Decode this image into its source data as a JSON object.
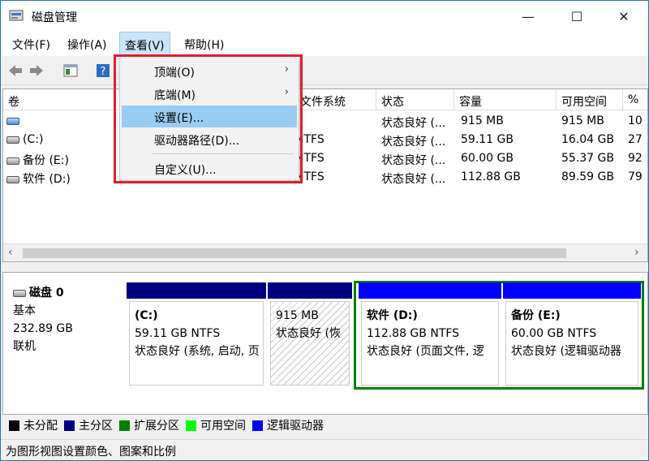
{
  "window": {
    "title": "磁盘管理",
    "minimize": "—",
    "maximize": "☐",
    "close": "✕"
  },
  "menubar": [
    {
      "label": "文件(F)"
    },
    {
      "label": "操作(A)"
    },
    {
      "label": "查看(V)"
    },
    {
      "label": "帮助(H)"
    }
  ],
  "view_menu": [
    {
      "label": "顶端(O)",
      "arrow": "›"
    },
    {
      "label": "底端(M)",
      "arrow": "›"
    },
    {
      "label": "设置(E)..."
    },
    {
      "label": "驱动器路径(D)..."
    },
    {
      "label": "自定义(U)..."
    }
  ],
  "volume_list": {
    "headers": [
      "卷",
      "文件系统",
      "状态",
      "容量",
      "可用空间",
      "%"
    ],
    "rows": [
      {
        "vol": "",
        "fs": "",
        "status": "状态良好 (...",
        "cap": "915 MB",
        "free": "915 MB",
        "pct": "10"
      },
      {
        "vol": "(C:)",
        "fs": "NTFS",
        "status": "状态良好 (...",
        "cap": "59.11 GB",
        "free": "16.04 GB",
        "pct": "27"
      },
      {
        "vol": "备份 (E:)",
        "fs": "NTFS",
        "status": "状态良好 (...",
        "cap": "60.00 GB",
        "free": "55.37 GB",
        "pct": "92"
      },
      {
        "vol": "软件 (D:)",
        "fs": "NTFS",
        "status": "状态良好 (...",
        "cap": "112.88 GB",
        "free": "89.59 GB",
        "pct": "79"
      }
    ],
    "scroll_left": "‹",
    "scroll_right": "›"
  },
  "disk": {
    "name": "磁盘 0",
    "type": "基本",
    "size": "232.89 GB",
    "state": "联机"
  },
  "partitions": [
    {
      "name": "(C:)",
      "size": "59.11 GB NTFS",
      "status": "状态良好 (系统, 启动, 页",
      "bar_color": "#000080"
    },
    {
      "name": "",
      "size": "915 MB",
      "status": "状态良好 (恢",
      "bar_color": "#000080"
    },
    {
      "name": "软件  (D:)",
      "size": "112.88 GB NTFS",
      "status": "状态良好 (页面文件, 逻",
      "bar_color": "#0000ff"
    },
    {
      "name": "备份  (E:)",
      "size": "60.00 GB NTFS",
      "status": "状态良好 (逻辑驱动器",
      "bar_color": "#0000ff"
    }
  ],
  "legend": [
    {
      "label": "未分配",
      "color": "#000000"
    },
    {
      "label": "主分区",
      "color": "#000080"
    },
    {
      "label": "扩展分区",
      "color": "#008000"
    },
    {
      "label": "可用空间",
      "color": "#00ff00"
    },
    {
      "label": "逻辑驱动器",
      "color": "#0000ff"
    }
  ],
  "status_bar": "为图形视图设置颜色、图案和比例"
}
